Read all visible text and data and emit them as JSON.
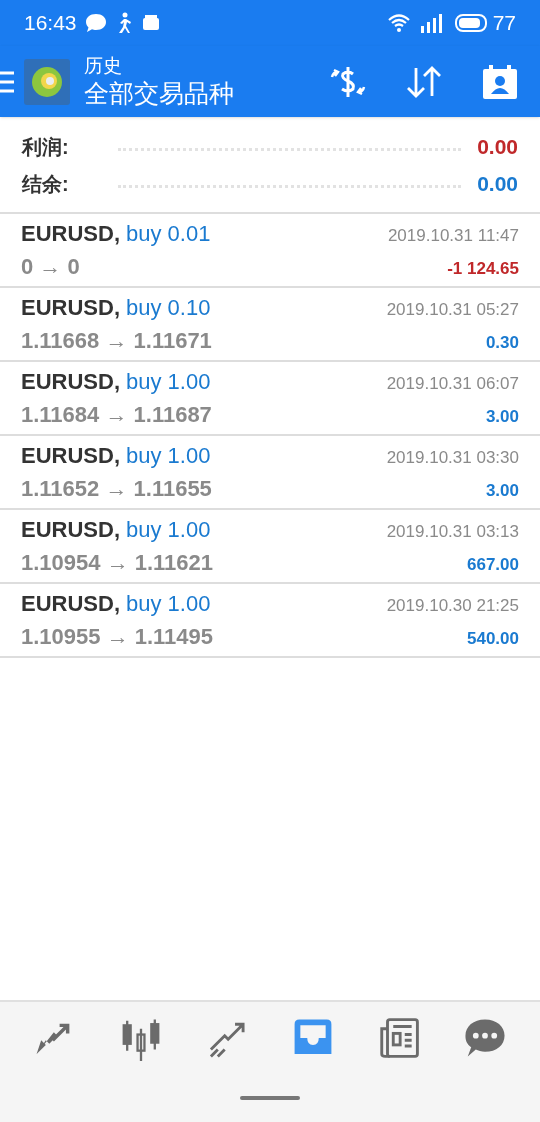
{
  "status_bar": {
    "time": "16:43",
    "battery": "77"
  },
  "toolbar": {
    "subtitle": "历史",
    "title": "全部交易品种"
  },
  "summary": [
    {
      "label": "利润:",
      "value": "0.00",
      "negative": true
    },
    {
      "label": "结余:",
      "value": "0.00",
      "negative": false
    }
  ],
  "trades": [
    {
      "symbol": "EURUSD,",
      "action": "buy 0.01",
      "prices": "0 → 0",
      "time": "2019.10.31 11:47",
      "profit": "-1 124.65",
      "negative": true
    },
    {
      "symbol": "EURUSD,",
      "action": "buy 0.10",
      "prices": "1.11668 → 1.11671",
      "time": "2019.10.31 05:27",
      "profit": "0.30",
      "negative": false
    },
    {
      "symbol": "EURUSD,",
      "action": "buy 1.00",
      "prices": "1.11684 → 1.11687",
      "time": "2019.10.31 06:07",
      "profit": "3.00",
      "negative": false
    },
    {
      "symbol": "EURUSD,",
      "action": "buy 1.00",
      "prices": "1.11652 → 1.11655",
      "time": "2019.10.31 03:30",
      "profit": "3.00",
      "negative": false
    },
    {
      "symbol": "EURUSD,",
      "action": "buy 1.00",
      "prices": "1.10954 → 1.11621",
      "time": "2019.10.31 03:13",
      "profit": "667.00",
      "negative": false
    },
    {
      "symbol": "EURUSD,",
      "action": "buy 1.00",
      "prices": "1.10955 → 1.11495",
      "time": "2019.10.30 21:25",
      "profit": "540.00",
      "negative": false
    }
  ],
  "nav": [
    {
      "kind": "quotes",
      "selected": false
    },
    {
      "kind": "chart",
      "selected": false
    },
    {
      "kind": "trade",
      "selected": false
    },
    {
      "kind": "history",
      "selected": true
    },
    {
      "kind": "news",
      "selected": false
    },
    {
      "kind": "chat",
      "selected": false
    }
  ]
}
